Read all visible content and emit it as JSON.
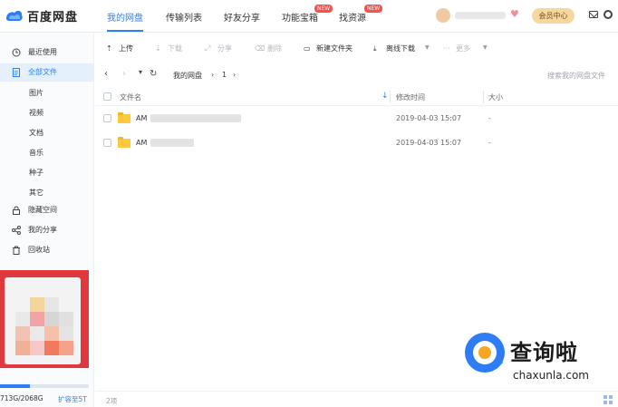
{
  "app": {
    "name": "百度网盘",
    "nav": [
      {
        "label": "我的网盘",
        "active": true
      },
      {
        "label": "传输列表"
      },
      {
        "label": "好友分享"
      },
      {
        "label": "功能宝箱",
        "badge": "NEW"
      },
      {
        "label": "找资源",
        "badge": "NEW"
      }
    ],
    "vip_label": "会员中心"
  },
  "sidebar": {
    "items": [
      {
        "label": "最近使用",
        "icon": "clock-icon"
      },
      {
        "label": "全部文件",
        "icon": "file-icon",
        "active": true
      }
    ],
    "sub_items": [
      "图片",
      "视频",
      "文档",
      "音乐",
      "种子",
      "其它"
    ],
    "extra_items": [
      {
        "label": "隐藏空间",
        "icon": "lock-icon"
      },
      {
        "label": "我的分享",
        "icon": "share-icon"
      },
      {
        "label": "回收站",
        "icon": "trash-icon"
      }
    ],
    "storage": {
      "text": "713G/2068G",
      "used_fraction": 0.34,
      "expand_label": "扩容至5T"
    }
  },
  "toolbar": {
    "upload": "上传",
    "download": "下载",
    "share": "分享",
    "delete": "删除",
    "new_folder": "新建文件夹",
    "offline_download": "离线下载",
    "more": "更多"
  },
  "breadcrumb": {
    "root": "我的网盘",
    "current": "1",
    "search_placeholder": "搜索我的网盘文件"
  },
  "table": {
    "columns": [
      "文件名",
      "修改时间",
      "大小"
    ],
    "rows": [
      {
        "name_prefix": "AM",
        "modified": "2019-04-03 15:07",
        "size": "-"
      },
      {
        "name_prefix": "AM",
        "modified": "2019-04-03 15:07",
        "size": "-"
      }
    ]
  },
  "footer": {
    "count": "2项"
  },
  "watermark": {
    "cn": "查询啦",
    "en": "chaxunla.com"
  },
  "colors": {
    "accent": "#2f7df6",
    "folder": "#ffc83d",
    "vip": "#f6d79e",
    "promo": "#e0383c",
    "badge": "#f5514d"
  }
}
